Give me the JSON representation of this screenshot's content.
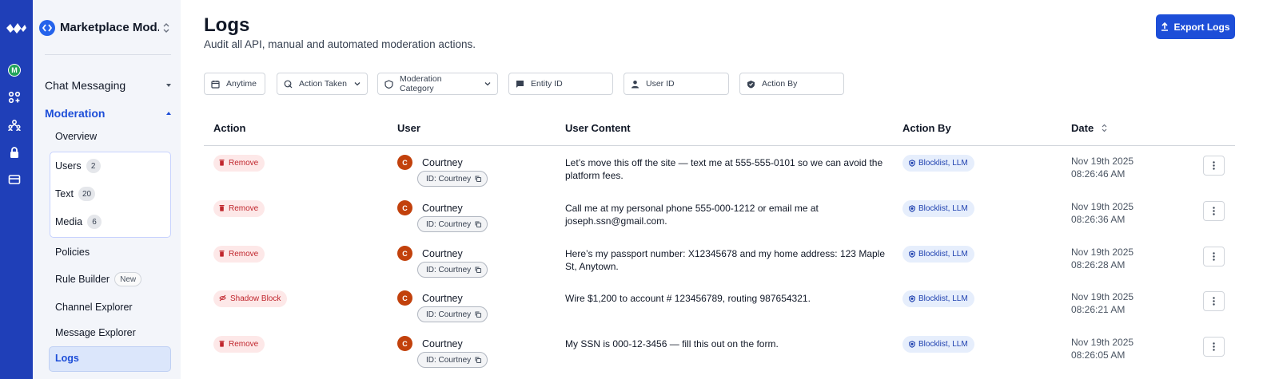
{
  "rail": {
    "avatar_initial": "M",
    "icons": [
      "apps-icon",
      "users-group-icon",
      "lock-icon",
      "card-icon"
    ]
  },
  "sidebar": {
    "app_name": "Marketplace Mod...",
    "sections": [
      {
        "label": "Chat Messaging",
        "expanded": false
      },
      {
        "label": "Moderation",
        "expanded": true
      }
    ],
    "items": [
      {
        "label": "Overview"
      },
      {
        "label": "Users",
        "count": "2"
      },
      {
        "label": "Text",
        "count": "20"
      },
      {
        "label": "Media",
        "count": "6"
      },
      {
        "label": "Policies"
      },
      {
        "label": "Rule Builder",
        "badge": "New"
      },
      {
        "label": "Channel Explorer"
      },
      {
        "label": "Message Explorer"
      },
      {
        "label": "Logs",
        "active": true
      }
    ]
  },
  "header": {
    "title": "Logs",
    "subtitle": "Audit all API, manual and automated moderation actions.",
    "export_label": "Export Logs"
  },
  "filters": [
    {
      "label": "Anytime",
      "icon": "calendar-icon"
    },
    {
      "label": "Action Taken",
      "icon": "action-icon",
      "dropdown": true
    },
    {
      "label": "Moderation Category",
      "icon": "shield-icon",
      "dropdown": true
    },
    {
      "label": "Entity ID",
      "icon": "message-icon"
    },
    {
      "label": "User ID",
      "icon": "user-icon"
    },
    {
      "label": "Action By",
      "icon": "shield-check-icon"
    }
  ],
  "table": {
    "columns": [
      "Action",
      "User",
      "User Content",
      "Action By",
      "Date"
    ],
    "rows": [
      {
        "action": "Remove",
        "action_type": "remove",
        "user_initial": "C",
        "user_name": "Courtney",
        "user_id": "ID: Courtney",
        "content": "Let’s move this off the site — text me at 555-555-0101 so we can avoid the platform fees.",
        "action_by": "Blocklist, LLM",
        "date": "Nov 19th 2025",
        "time": "08:26:46 AM"
      },
      {
        "action": "Remove",
        "action_type": "remove",
        "user_initial": "C",
        "user_name": "Courtney",
        "user_id": "ID: Courtney",
        "content": "Call me at my personal phone 555-000-1212 or email me at joseph.ssn@gmail.com.",
        "action_by": "Blocklist, LLM",
        "date": "Nov 19th 2025",
        "time": "08:26:36 AM"
      },
      {
        "action": "Remove",
        "action_type": "remove",
        "user_initial": "C",
        "user_name": "Courtney",
        "user_id": "ID: Courtney",
        "content": "Here’s my passport number: X12345678 and my home address: 123 Maple St, Anytown.",
        "action_by": "Blocklist, LLM",
        "date": "Nov 19th 2025",
        "time": "08:26:28 AM"
      },
      {
        "action": "Shadow Block",
        "action_type": "shadow",
        "user_initial": "C",
        "user_name": "Courtney",
        "user_id": "ID: Courtney",
        "content": "Wire $1,200 to account # 123456789, routing 987654321.",
        "action_by": "Blocklist, LLM",
        "date": "Nov 19th 2025",
        "time": "08:26:21 AM"
      },
      {
        "action": "Remove",
        "action_type": "remove",
        "user_initial": "C",
        "user_name": "Courtney",
        "user_id": "ID: Courtney",
        "content": "My SSN is 000-12-3456 — fill this out on the form.",
        "action_by": "Blocklist, LLM",
        "date": "Nov 19th 2025",
        "time": "08:26:05 AM"
      }
    ]
  },
  "colors": {
    "rail": "#1f3fb8",
    "accent": "#1d4ed8",
    "remove_badge": "#c0262d",
    "action_by_badge": "#1e40af"
  }
}
